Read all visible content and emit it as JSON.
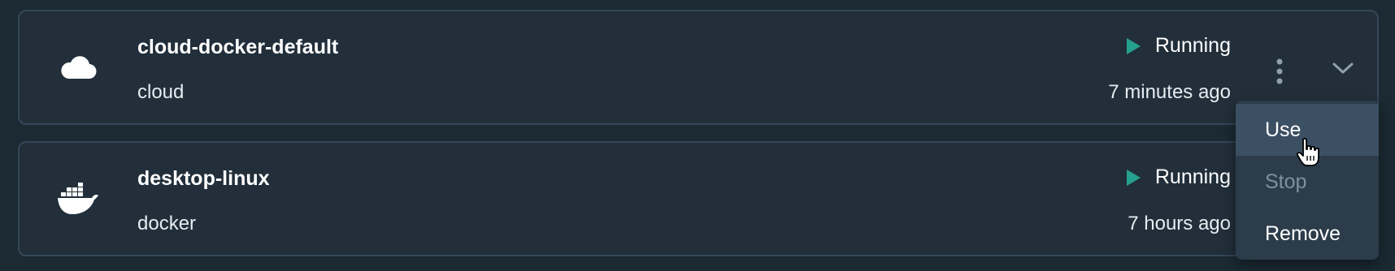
{
  "builders": [
    {
      "name": "cloud-docker-default",
      "driver": "cloud",
      "status": "Running",
      "updated": "7 minutes ago",
      "icon": "cloud-icon"
    },
    {
      "name": "desktop-linux",
      "driver": "docker",
      "status": "Running",
      "updated": "7 hours ago",
      "icon": "docker-whale-icon"
    }
  ],
  "actions_menu": {
    "items": [
      {
        "label": "Use",
        "state": "hovered"
      },
      {
        "label": "Stop",
        "state": "disabled"
      },
      {
        "label": "Remove",
        "state": "enabled"
      }
    ]
  },
  "colors": {
    "background": "#1b2a33",
    "card": "#222f3b",
    "card_border": "#34475a",
    "running_accent": "#25a18f",
    "menu": "#2c3c4b",
    "menu_hover": "#3b5062",
    "disabled_text": "#7f8f9c"
  }
}
